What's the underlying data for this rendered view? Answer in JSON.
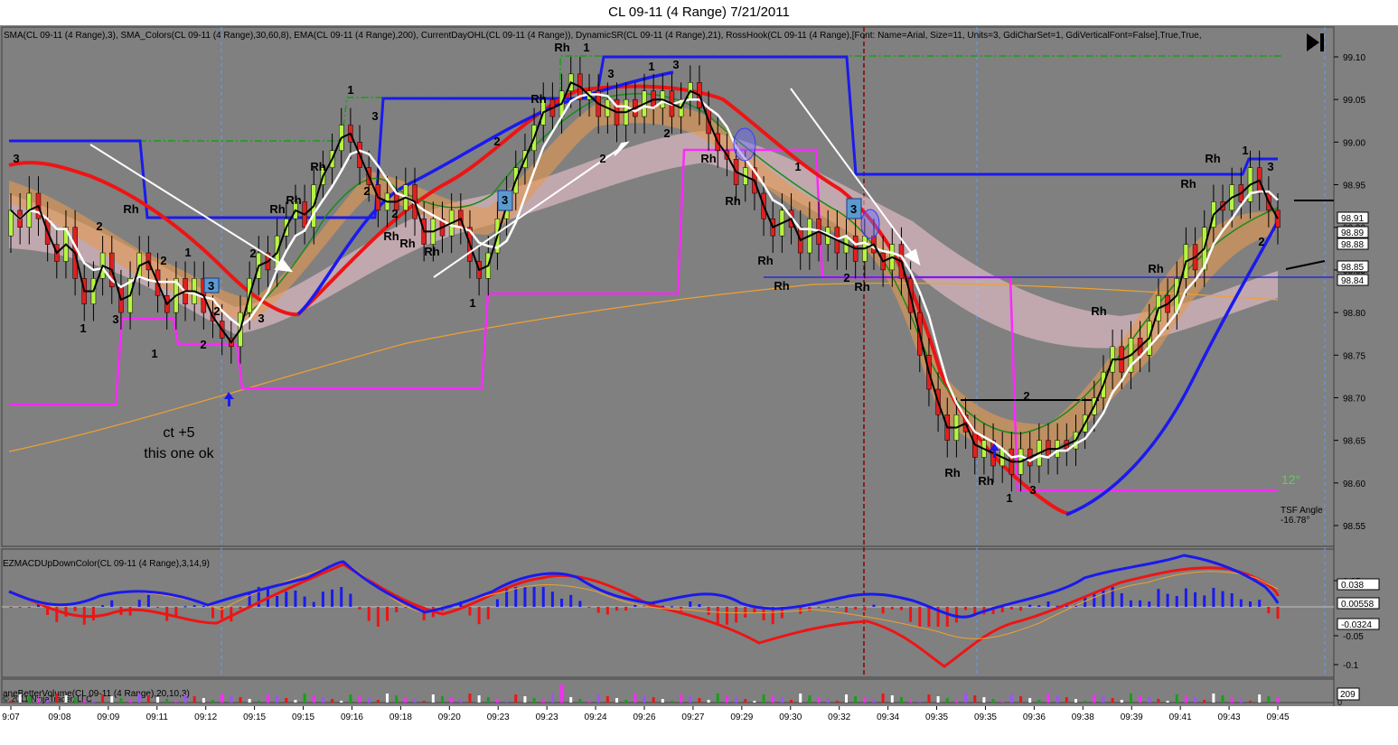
{
  "window": {
    "title": "CL 09-11 (4 Range)  7/21/2011"
  },
  "price_panel": {
    "indicator_header": "SMA(CL 09-11 (4 Range),3), SMA_Colors(CL 09-11 (4 Range),30,60,8), EMA(CL 09-11 (4 Range),200), CurrentDayOHL(CL 09-11 (4 Range)), DynamicSR(CL 09-11 (4 Range),21), RossHook(CL 09-11 (4 Range),[Font: Name=Arial, Size=11, Units=3, GdiCharSet=1, GdiVerticalFont=False],True,True,",
    "price_ticks": [
      "99.10",
      "99.05",
      "99.00",
      "98.95",
      "98.90",
      "98.85",
      "98.80",
      "98.75",
      "98.70",
      "98.65",
      "98.60",
      "98.55"
    ],
    "price_boxes": [
      "98.91",
      "98.89",
      "98.88",
      "98.85",
      "98.84"
    ],
    "annotation_line1": "ct +5",
    "annotation_line2": "this one ok",
    "tsf_label": "TSF Angle",
    "tsf_value": "-16.78°",
    "angle_label": "12°",
    "labels": {
      "rh": "Rh",
      "n1": "1",
      "n2": "2",
      "n3": "3"
    }
  },
  "macd_panel": {
    "header": "EZMACDUpDownColor(CL 09-11 (4 Range),3,14,9)",
    "ticks": [
      "0.05",
      "-0.05",
      "-0.1"
    ],
    "boxes": [
      "0.038",
      "0.00558",
      "-0.0324"
    ]
  },
  "volume_panel": {
    "header": "aneBetterVolume(CL 09-11 (4 Range),20,10,3)",
    "copyright": "© 2011 NinjaTrader, LLC",
    "box": "209",
    "tick": "0"
  },
  "time_axis": [
    "9:07",
    "09:08",
    "09:09",
    "09:11",
    "09:12",
    "09:15",
    "09:15",
    "09:16",
    "09:18",
    "09:20",
    "09:23",
    "09:23",
    "09:24",
    "09:26",
    "09:27",
    "09:29",
    "09:30",
    "09:32",
    "09:34",
    "09:35",
    "09:35",
    "09:36",
    "09:38",
    "09:39",
    "09:41",
    "09:43",
    "09:45"
  ],
  "colors": {
    "background": "#808080",
    "up_candle": "#b5f542",
    "down_candle": "#e02020",
    "sma_white": "#ffffff",
    "ema200": "#f0a030",
    "dynamic_blue": "#1a1aee",
    "pink_sr": "#ff28ff",
    "green_dash": "#16a016",
    "red_ma": "#ee1414"
  },
  "chart_data": {
    "type": "candlestick",
    "instrument": "CL 09-11 (4 Range)",
    "date": "7/21/2011",
    "ylim": [
      98.52,
      99.14
    ],
    "closes": [
      98.92,
      98.9,
      98.94,
      98.91,
      98.88,
      98.86,
      98.9,
      98.84,
      98.81,
      98.84,
      98.87,
      98.83,
      98.8,
      98.84,
      98.87,
      98.85,
      98.82,
      98.8,
      98.84,
      98.81,
      98.84,
      98.8,
      98.79,
      98.77,
      98.76,
      98.8,
      98.84,
      98.87,
      98.85,
      98.89,
      98.91,
      98.93,
      98.9,
      98.95,
      98.97,
      98.99,
      99.02,
      99.0,
      98.97,
      98.95,
      98.92,
      98.94,
      98.92,
      98.95,
      98.91,
      98.88,
      98.91,
      98.89,
      98.92,
      98.9,
      98.86,
      98.84,
      98.87,
      98.91,
      98.94,
      98.97,
      98.99,
      99.02,
      99.05,
      99.03,
      99.06,
      99.08,
      99.05,
      99.06,
      99.03,
      99.05,
      99.02,
      99.05,
      99.03,
      99.06,
      99.04,
      99.06,
      99.03,
      99.05,
      99.07,
      99.04,
      99.01,
      98.99,
      98.98,
      98.95,
      98.97,
      98.94,
      98.91,
      98.89,
      98.92,
      98.9,
      98.87,
      98.91,
      98.88,
      98.9,
      98.87,
      98.89,
      98.86,
      98.89,
      98.87,
      98.85,
      98.88,
      98.84,
      98.8,
      98.75,
      98.71,
      98.68,
      98.65,
      98.68,
      98.66,
      98.63,
      98.65,
      98.62,
      98.64,
      98.61,
      98.64,
      98.62,
      98.65,
      98.63,
      98.65,
      98.64,
      98.66,
      98.68,
      98.7,
      98.73,
      98.76,
      98.73,
      98.77,
      98.75,
      98.79,
      98.82,
      98.8,
      98.84,
      98.88,
      98.85,
      98.9,
      98.93,
      98.92,
      98.95,
      98.93,
      98.97,
      98.94,
      98.92,
      98.9
    ]
  }
}
